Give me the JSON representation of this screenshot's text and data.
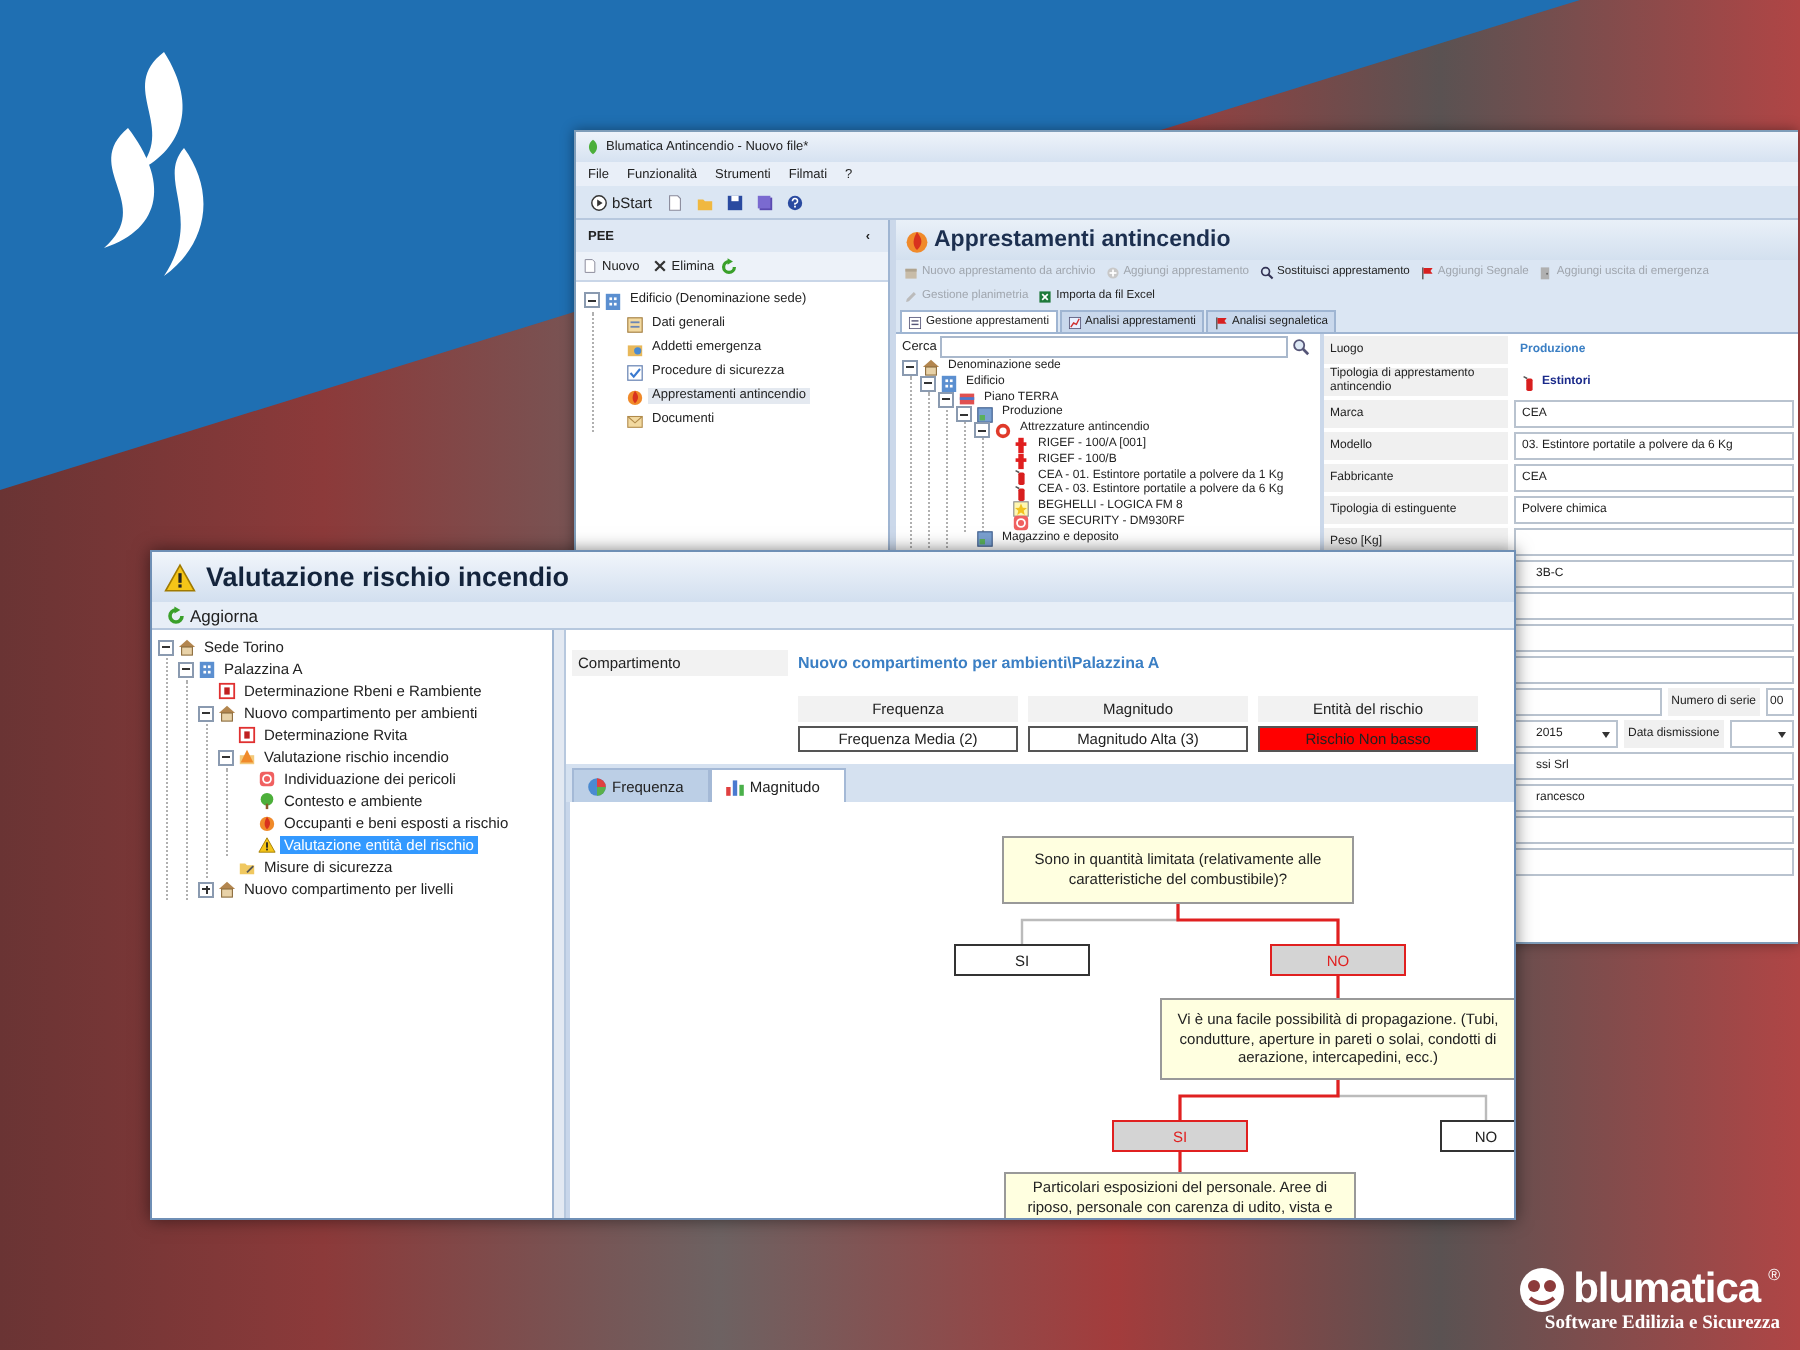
{
  "brand_logo": {
    "name": "blumatica",
    "mark": "®",
    "tagline": "Software Edilizia e Sicurezza"
  },
  "back_window": {
    "title": "Blumatica Antincendio - Nuovo file*",
    "menu": [
      {
        "label": "File"
      },
      {
        "label": "Funzionalità"
      },
      {
        "label": "Strumenti"
      },
      {
        "label": "Filmati"
      },
      {
        "label": "?"
      }
    ],
    "toolbar": {
      "start_button": "bStart"
    },
    "side_panel": {
      "title": "PEE",
      "collapse": "‹",
      "actions": [
        {
          "kind": "new",
          "label": "Nuovo"
        },
        {
          "kind": "delete",
          "label": "Elimina"
        },
        {
          "kind": "refresh"
        }
      ],
      "tree": [
        {
          "label": "Edificio (Denominazione sede)",
          "kind": "building",
          "expanded": true,
          "selected": false,
          "children": [
            {
              "label": "Dati generali",
              "kind": "form",
              "selected": false
            },
            {
              "label": "Addetti emergenza",
              "kind": "people",
              "selected": false
            },
            {
              "label": "Procedure di sicurezza",
              "kind": "checklist",
              "selected": false
            },
            {
              "label": "Apprestamenti antincendio",
              "kind": "flame",
              "selected": true
            },
            {
              "label": "Documenti",
              "kind": "envelope",
              "selected": false
            }
          ]
        }
      ]
    },
    "main_panel": {
      "title": "Apprestamenti antincendio",
      "action_rows": [
        [
          {
            "kind": "archive",
            "label": "Nuovo apprestamento da archivio",
            "disabled": true
          },
          {
            "kind": "add",
            "label": "Aggiungi apprestamento",
            "disabled": true
          },
          {
            "kind": "replace",
            "label": "Sostituisci apprestamento",
            "disabled": false
          },
          {
            "kind": "signal",
            "label": "Aggiungi Segnale",
            "disabled": true
          },
          {
            "kind": "exit",
            "label": "Aggiungi uscita di emergenza",
            "disabled": true
          }
        ],
        [
          {
            "kind": "plan",
            "label": "Gestione planimetria",
            "disabled": true
          },
          {
            "kind": "excel",
            "label": "Importa da fil Excel",
            "disabled": false
          }
        ]
      ],
      "tabs": [
        {
          "kind": "list",
          "label": "Gestione apprestamenti",
          "selected": true
        },
        {
          "kind": "chart",
          "label": "Analisi apprestamenti",
          "selected": false
        },
        {
          "kind": "signal",
          "label": "Analisi segnaletica",
          "selected": false
        }
      ],
      "search": {
        "label": "Cerca"
      },
      "tree": [
        {
          "label": "Denominazione sede",
          "kind": "house",
          "expanded": true,
          "selected": false,
          "children": [
            {
              "label": "Edificio",
              "kind": "building",
              "expanded": true,
              "selected": false,
              "children": [
                {
                  "label": "Piano TERRA",
                  "kind": "floor",
                  "expanded": true,
                  "selected": false,
                  "children": [
                    {
                      "label": "Produzione",
                      "kind": "room",
                      "expanded": true,
                      "selected": false,
                      "children": [
                        {
                          "label": "Attrezzature antincendio",
                          "kind": "ring",
                          "expanded": true,
                          "selected": false,
                          "children": [
                            {
                              "label": "RIGEF - 100/A [001]",
                              "kind": "hydrant",
                              "selected": false
                            },
                            {
                              "label": "RIGEF - 100/B",
                              "kind": "hydrant",
                              "selected": false
                            },
                            {
                              "label": "CEA - 01. Estintore portatile a polvere da 1 Kg",
                              "kind": "extinguisher",
                              "selected": false
                            },
                            {
                              "label": "CEA - 03. Estintore portatile a polvere da 6 Kg",
                              "kind": "extinguisher",
                              "selected": false
                            },
                            {
                              "label": "BEGHELLI - LOGICA FM 8",
                              "kind": "lamp",
                              "selected": false
                            },
                            {
                              "label": "GE SECURITY - DM930RF",
                              "kind": "alarm",
                              "selected": false
                            }
                          ]
                        }
                      ]
                    },
                    {
                      "label": "Magazzino e deposito",
                      "kind": "room",
                      "selected": false
                    }
                  ]
                }
              ]
            }
          ]
        }
      ],
      "properties": [
        {
          "kind": "link",
          "label": "Luogo",
          "value": "Produzione"
        },
        {
          "kind": "type",
          "label": "Tipologia di apprestamento antincendio",
          "value": "Estintori"
        },
        {
          "kind": "field",
          "label": "Marca",
          "value": "CEA"
        },
        {
          "kind": "field",
          "label": "Modello",
          "value": "03. Estintore portatile a polvere da 6 Kg"
        },
        {
          "kind": "field",
          "label": "Fabbricante",
          "value": "CEA"
        },
        {
          "kind": "field",
          "label": "Tipologia di estinguente",
          "value": "Polvere chimica"
        },
        {
          "kind": "field",
          "label": "Peso [Kg]"
        }
      ],
      "lower_rows": [
        {
          "kind": "field",
          "value": "3B-C"
        },
        {
          "kind": "field"
        },
        {
          "kind": "field"
        },
        {
          "kind": "field"
        },
        {
          "kind": "serial",
          "label": "Numero di serie",
          "value": "00"
        },
        {
          "kind": "dates",
          "value": "2015",
          "label": "Data dismissione"
        },
        {
          "kind": "field",
          "value": "ssi Srl"
        },
        {
          "kind": "field",
          "value": "rancesco"
        },
        {
          "kind": "field"
        },
        {
          "kind": "field"
        }
      ]
    }
  },
  "front_window": {
    "title": "Valutazione rischio incendio",
    "refresh_button": "Aggiorna",
    "tree": [
      {
        "label": "Sede Torino",
        "kind": "house",
        "expanded": true,
        "selected": false,
        "children": [
          {
            "label": "Palazzina A",
            "kind": "building",
            "expanded": true,
            "selected": false,
            "children": [
              {
                "label": "Determinazione Rbeni e Rambiente",
                "kind": "framed",
                "selected": false
              },
              {
                "label": "Nuovo compartimento per ambienti",
                "kind": "house",
                "expanded": true,
                "selected": false,
                "children": [
                  {
                    "label": "Determinazione Rvita",
                    "kind": "framed",
                    "selected": false
                  },
                  {
                    "label": "Valutazione rischio incendio",
                    "kind": "triangle",
                    "expanded": true,
                    "selected": false,
                    "children": [
                      {
                        "label": "Individuazione dei pericoli",
                        "kind": "alarm",
                        "selected": false
                      },
                      {
                        "label": "Contesto e ambiente",
                        "kind": "tree",
                        "selected": false
                      },
                      {
                        "label": "Occupanti e beni esposti a rischio",
                        "kind": "flame",
                        "selected": false
                      },
                      {
                        "label": "Valutazione entità del rischio",
                        "kind": "warning",
                        "selected": true
                      }
                    ]
                  },
                  {
                    "label": "Misure di sicurezza",
                    "kind": "folder",
                    "selected": false
                  }
                ]
              },
              {
                "label": "Nuovo compartimento per livelli",
                "kind": "house",
                "expanded": false,
                "selected": false
              }
            ]
          }
        ]
      }
    ],
    "compartment": {
      "label": "Compartimento",
      "value": "Nuovo compartimento per ambienti\\Palazzina A"
    },
    "summary": [
      {
        "heading": "Frequenza",
        "value": "Frequenza Media (2)",
        "color": "#ffffff"
      },
      {
        "heading": "Magnitudo",
        "value": "Magnitudo Alta (3)",
        "color": "#ffffff"
      },
      {
        "heading": "Entità del rischio",
        "value": "Rischio Non basso",
        "color": "#ff0000"
      }
    ],
    "tabs": [
      {
        "kind": "pie",
        "label": "Frequenza",
        "selected": false
      },
      {
        "kind": "bars",
        "label": "Magnitudo",
        "selected": true
      }
    ],
    "flowchart": {
      "question": "Sono in quantità limitata (relativamente alle caratteristiche del combustibile)?",
      "answers": [
        {
          "label": "SI",
          "selected": false
        },
        {
          "label": "NO",
          "selected": true,
          "next": {
            "question": "Vi è una facile possibilità di propagazione. (Tubi, condutture, aperture in pareti o solai, condotti di aerazione, intercapedini, ecc.)",
            "answers": [
              {
                "label": "SI",
                "selected": true,
                "next": {
                  "question": "Particolari esposizioni del personale. Aree di riposo, personale con carenza di udito, vista e"
                }
              },
              {
                "label": "NO",
                "selected": false
              }
            ]
          }
        }
      ]
    }
  }
}
